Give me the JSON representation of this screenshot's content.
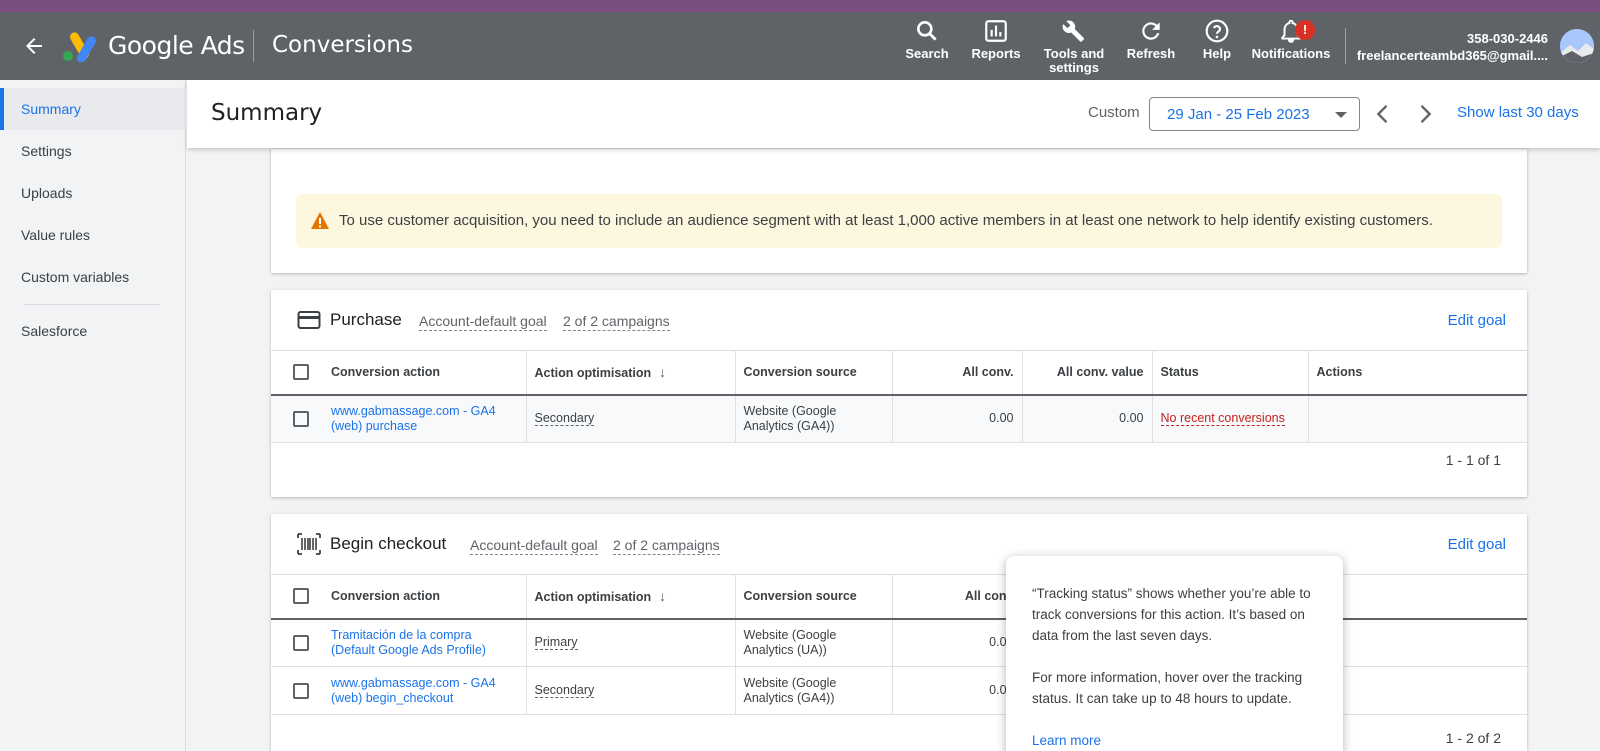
{
  "header": {
    "brand": "Google Ads",
    "page": "Conversions",
    "buttons": [
      {
        "label": "Search",
        "icon": "search-icon"
      },
      {
        "label": "Reports",
        "icon": "reports-icon"
      },
      {
        "label": "Tools and settings",
        "icon": "wrench-icon"
      },
      {
        "label": "Refresh",
        "icon": "refresh-icon"
      },
      {
        "label": "Help",
        "icon": "help-icon"
      },
      {
        "label": "Notifications",
        "icon": "bell-icon",
        "badge": "!"
      }
    ],
    "account_id": "358-030-2446",
    "account_email": "freelancerteambd365@gmail...."
  },
  "sidebar": {
    "items": [
      {
        "label": "Summary",
        "active": true
      },
      {
        "label": "Settings"
      },
      {
        "label": "Uploads"
      },
      {
        "label": "Value rules"
      },
      {
        "label": "Custom variables"
      },
      {
        "label": "Salesforce"
      }
    ]
  },
  "titlebar": {
    "title": "Summary",
    "custom_label": "Custom",
    "date_range": "29 Jan - 25 Feb 2023",
    "show_last": "Show last 30 days"
  },
  "warning": {
    "text": "To use customer acquisition, you need to include an audience segment with at least 1,000 active members in at least one network to help identify existing customers."
  },
  "columns": {
    "conversion_action": "Conversion action",
    "action_optimisation": "Action optimisation",
    "conversion_source": "Conversion source",
    "all_conv": "All conv.",
    "all_conv_value": "All conv. value",
    "status": "Status",
    "actions": "Actions"
  },
  "goals": [
    {
      "name": "Purchase",
      "goal_type": "Account-default goal",
      "campaigns": "2 of 2 campaigns",
      "edit": "Edit goal",
      "rows": [
        {
          "action": "www.gabmassage.com - GA4 (web) purchase",
          "optimisation": "Secondary",
          "source": "Website (Google Analytics (GA4))",
          "all_conv": "0.00",
          "all_conv_value": "0.00",
          "status": "No recent conversions"
        }
      ],
      "pager": "1 - 1 of 1"
    },
    {
      "name": "Begin checkout",
      "goal_type": "Account-default goal",
      "campaigns": "2 of 2 campaigns",
      "edit": "Edit goal",
      "rows": [
        {
          "action": "Tramitación de la compra (Default Google Ads Profile)",
          "optimisation": "Primary",
          "source": "Website (Google Analytics (UA))",
          "all_conv": "0.00"
        },
        {
          "action": "www.gabmassage.com - GA4 (web) begin_checkout",
          "optimisation": "Secondary",
          "source": "Website (Google Analytics (GA4))",
          "all_conv": "0.00"
        }
      ],
      "pager": "1 - 2 of 2",
      "all_conv_header_visible": "All conv",
      "actions_header_visible": "ns"
    }
  ],
  "tooltip": {
    "para1": "“Tracking status” shows whether you’re able to track conversions for this action. It’s based on data from the last seven days.",
    "para2": "For more information, hover over the tracking status. It can take up to 48 hours to update.",
    "link": "Learn more"
  },
  "colors": {
    "header_bg": "#5f6368",
    "accent": "#1a73e8",
    "warning_bg": "#fef7e0",
    "error": "#c5221f"
  }
}
